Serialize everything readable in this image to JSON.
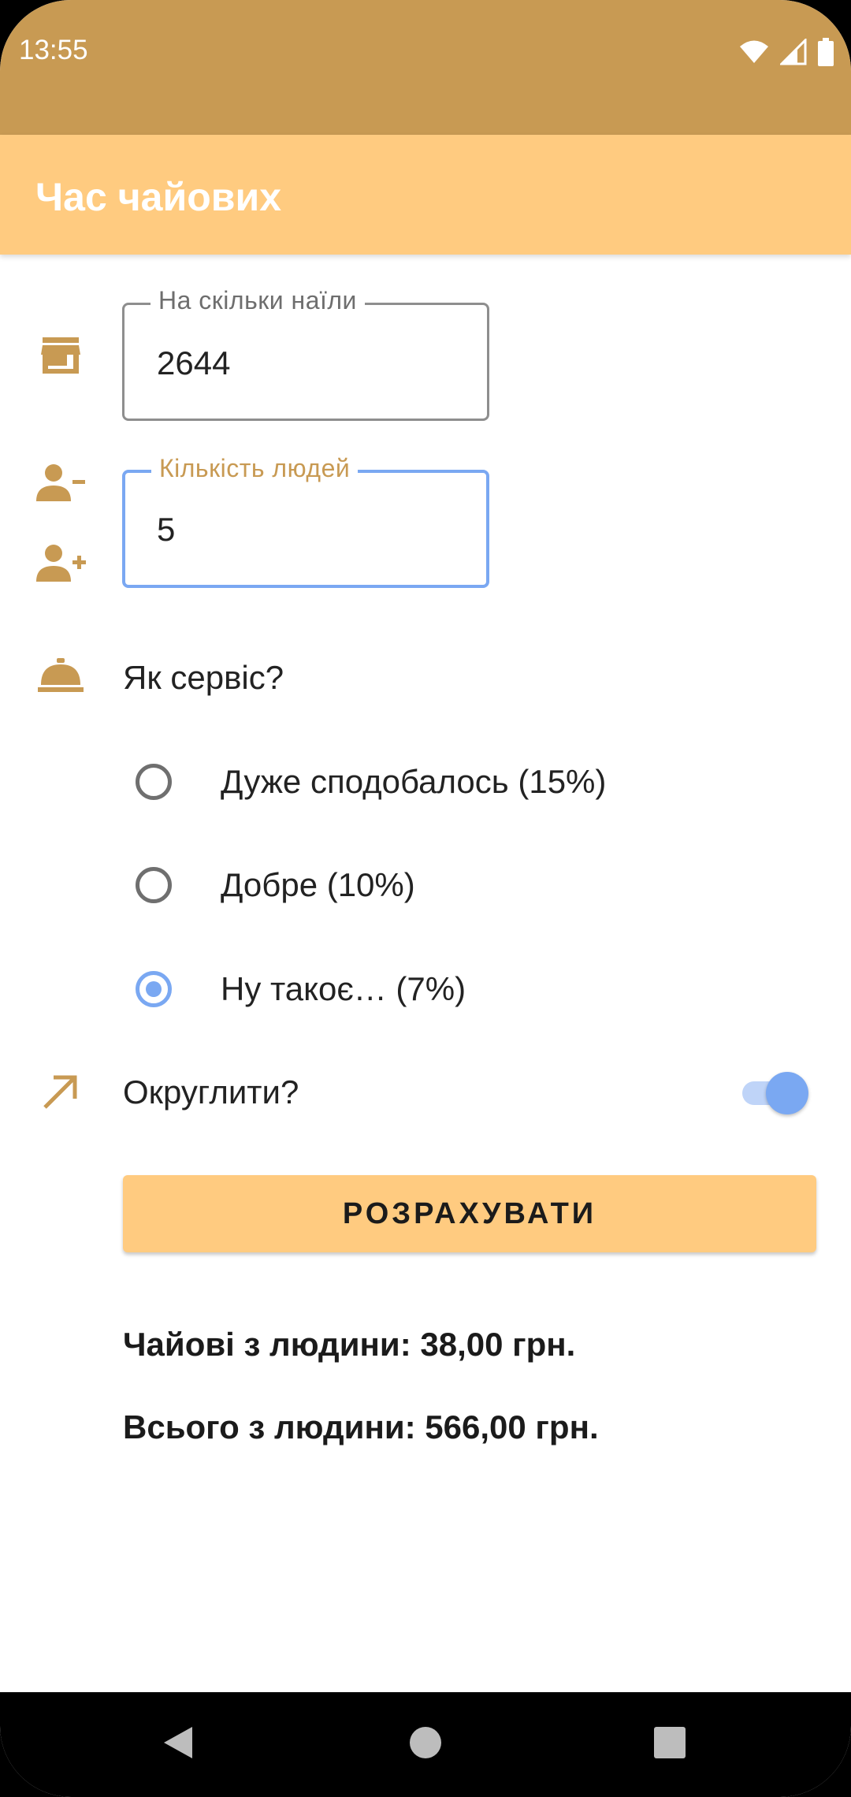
{
  "status_bar": {
    "time": "13:55"
  },
  "app_bar": {
    "title": "Час чайових"
  },
  "cost_field": {
    "label": "На скільки наїли",
    "value": "2644"
  },
  "people_field": {
    "label": "Кількість людей",
    "value": "5"
  },
  "service": {
    "question": "Як сервіс?",
    "options": [
      {
        "label": "Дуже сподобалось (15%)",
        "checked": false
      },
      {
        "label": "Добре (10%)",
        "checked": false
      },
      {
        "label": "Ну такоє… (7%)",
        "checked": true
      }
    ]
  },
  "round_up": {
    "label": "Округлити?",
    "enabled": true
  },
  "calculate_button": {
    "label": "РОЗРАХУВАТИ"
  },
  "results": {
    "tip_per_person": "Чайові з людини: 38,00 грн.",
    "total_per_person": "Всього з людини: 566,00 грн."
  },
  "colors": {
    "primary": "#ffcb80",
    "primary_dark": "#c89a53",
    "accent": "#7aa8f2"
  },
  "icons": [
    "wifi-icon",
    "signal-icon",
    "battery-icon",
    "store-icon",
    "person-remove-icon",
    "person-add-icon",
    "room-service-icon",
    "arrow-up-right-icon",
    "back-icon",
    "home-icon",
    "recents-icon"
  ]
}
